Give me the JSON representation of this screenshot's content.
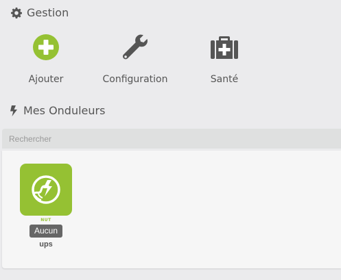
{
  "gestion": {
    "title": "Gestion",
    "icon": "gear-icon",
    "actions": [
      {
        "label": "Ajouter",
        "icon": "plus-circle-icon",
        "color": "#95c133"
      },
      {
        "label": "Configuration",
        "icon": "wrench-icon",
        "color": "#555555"
      },
      {
        "label": "Santé",
        "icon": "medkit-icon",
        "color": "#555555"
      }
    ]
  },
  "onduleurs": {
    "title": "Mes Onduleurs",
    "icon": "bolt-icon",
    "search": {
      "placeholder": "Rechercher",
      "value": ""
    },
    "items": [
      {
        "plugin_tag": "NUT",
        "status_badge": "Aucun",
        "name": "ups",
        "icon": "nut-plugin-icon",
        "tile_color": "#95c133"
      }
    ]
  }
}
